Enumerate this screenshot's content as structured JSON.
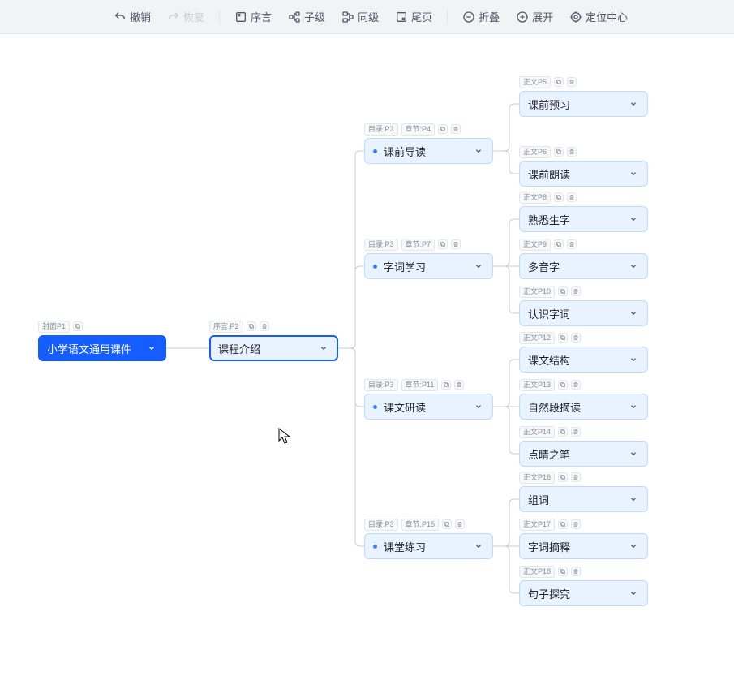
{
  "toolbar": {
    "undo": "撤销",
    "redo": "恢复",
    "preface": "序言",
    "child": "子级",
    "sibling": "同级",
    "epilogue": "尾页",
    "collapse": "折叠",
    "expand": "展开",
    "center": "定位中心"
  },
  "nodes": {
    "root": {
      "label": "小学语文通用课件",
      "tag1": "封面P1"
    },
    "intro": {
      "label": "课程介绍",
      "tag1": "序言:P2"
    },
    "sec1": {
      "label": "课前导读",
      "tag1": "目录:P3",
      "tag2": "章节:P4"
    },
    "sec2": {
      "label": "字词学习",
      "tag1": "目录:P3",
      "tag2": "章节:P7"
    },
    "sec3": {
      "label": "课文研读",
      "tag1": "目录:P3",
      "tag2": "章节:P11"
    },
    "sec4": {
      "label": "课堂练习",
      "tag1": "目录:P3",
      "tag2": "章节:P15"
    },
    "leaf1": {
      "label": "课前预习",
      "tag1": "正文P5"
    },
    "leaf2": {
      "label": "课前朗读",
      "tag1": "正文P6"
    },
    "leaf3": {
      "label": "熟悉生字",
      "tag1": "正文P8"
    },
    "leaf4": {
      "label": "多音字",
      "tag1": "正文P9"
    },
    "leaf5": {
      "label": "认识字词",
      "tag1": "正文P10"
    },
    "leaf6": {
      "label": "课文结构",
      "tag1": "正文P12"
    },
    "leaf7": {
      "label": "自然段摘读",
      "tag1": "正文P13"
    },
    "leaf8": {
      "label": "点睛之笔",
      "tag1": "正文P14"
    },
    "leaf9": {
      "label": "组词",
      "tag1": "正文P16"
    },
    "leaf10": {
      "label": "字词摘释",
      "tag1": "正文P17"
    },
    "leaf11": {
      "label": "句子探究",
      "tag1": "正文P18"
    }
  }
}
